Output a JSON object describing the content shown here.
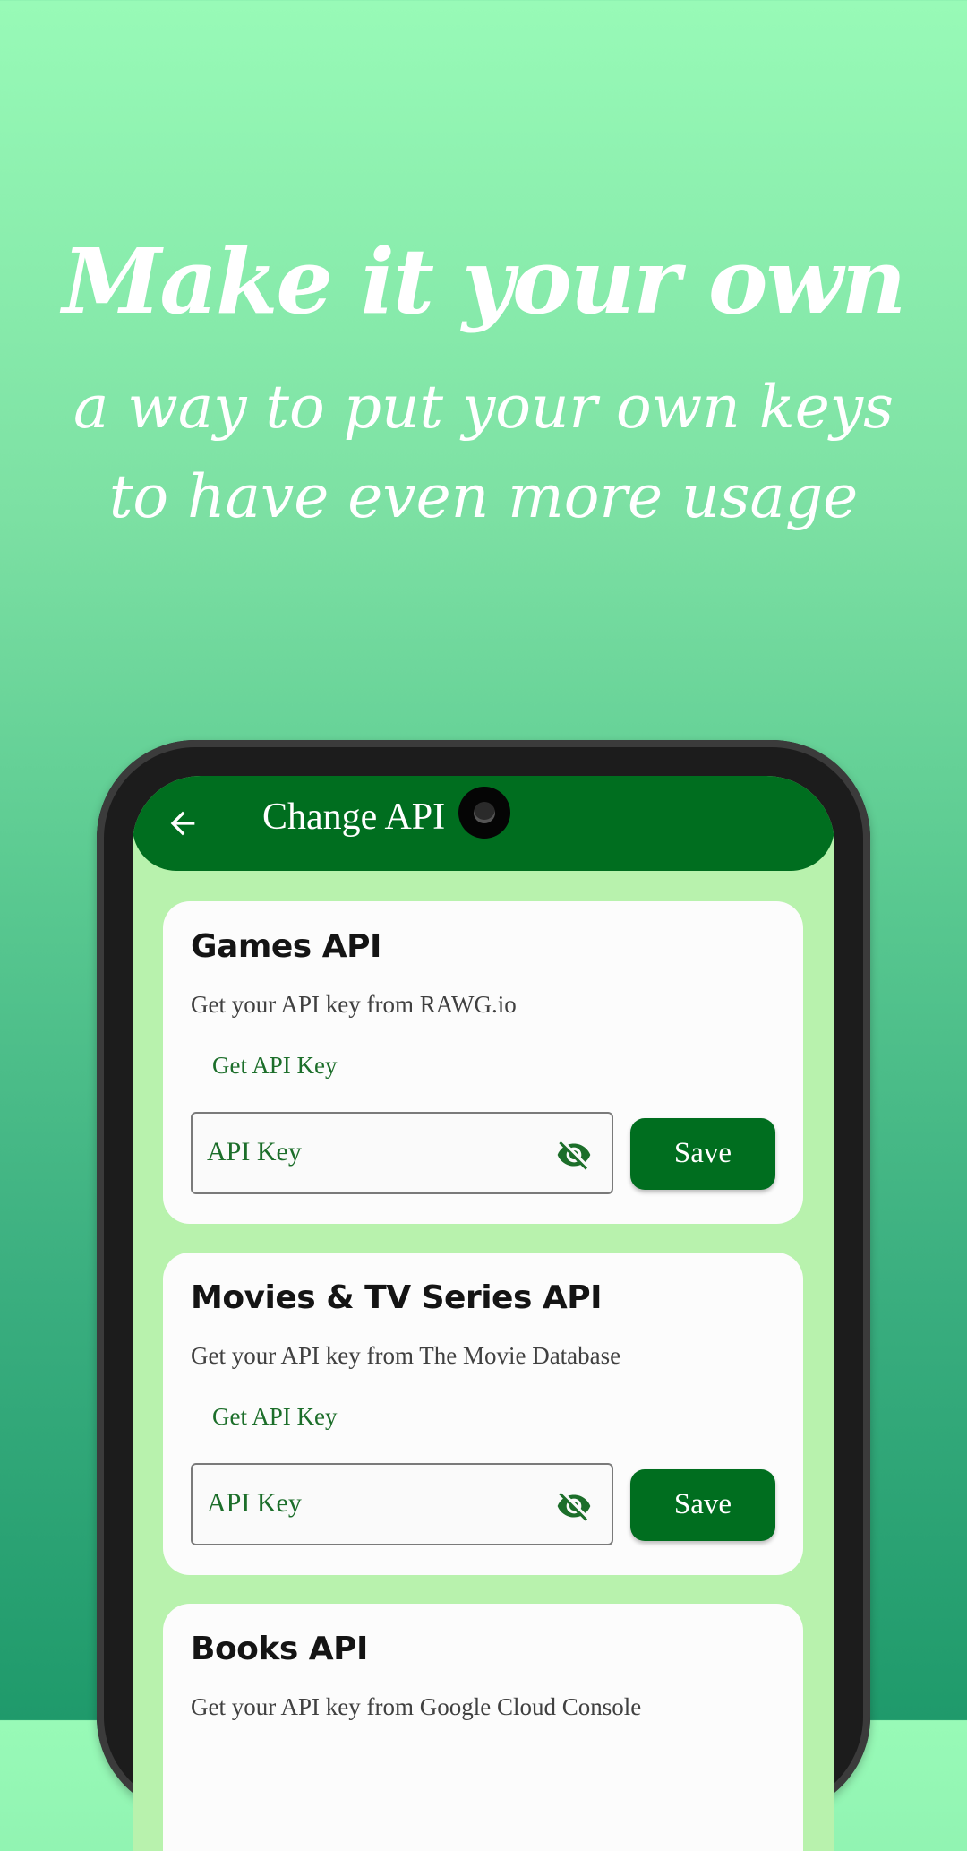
{
  "promo": {
    "headline": "Make it your own",
    "subline": "a way to put your own keys to have even more usage"
  },
  "appbar": {
    "title": "Change API"
  },
  "cards": [
    {
      "title": "Games API",
      "description": "Get your API key from RAWG.io",
      "link_label": "Get API Key",
      "field_placeholder": "API Key",
      "save_label": "Save"
    },
    {
      "title": "Movies & TV Series API",
      "description": "Get your API key from The Movie Database",
      "link_label": "Get API Key",
      "field_placeholder": "API Key",
      "save_label": "Save"
    },
    {
      "title": "Books API",
      "description": "Get your API key from Google Cloud Console"
    }
  ],
  "icons": {
    "back": "arrow-back-icon",
    "visibility": "visibility-off-icon",
    "camera": "camera-cutout"
  },
  "colors": {
    "primary": "#006e1f",
    "screen_background": "#b8f2ad",
    "link": "#1c6e2a",
    "card": "#fcfcfc"
  }
}
